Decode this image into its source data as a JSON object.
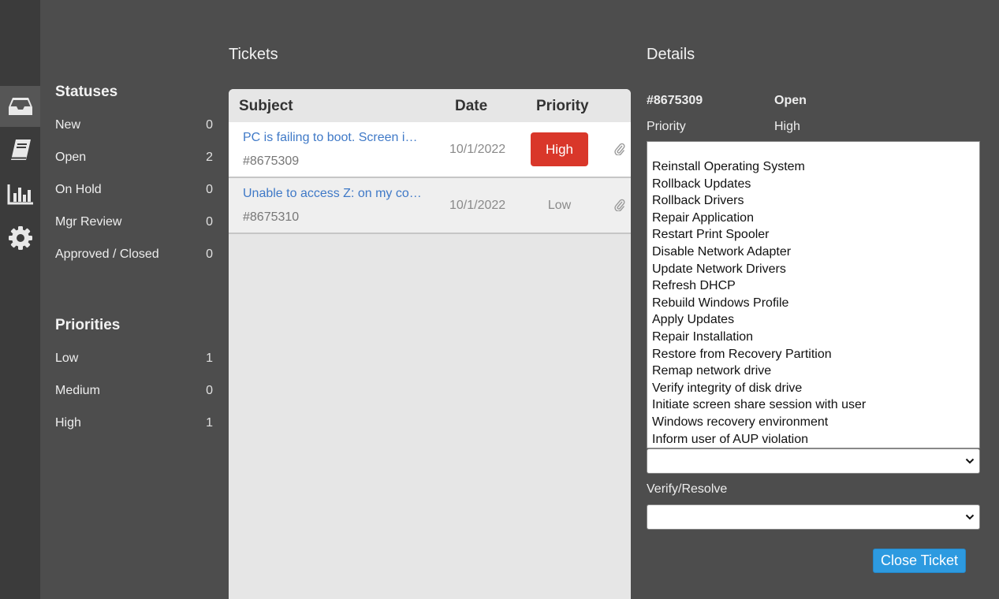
{
  "nav": {
    "icons": [
      "inbox-icon",
      "book-icon",
      "bar-chart-icon",
      "gear-icon"
    ],
    "active": "inbox-icon"
  },
  "statuses": {
    "title": "Statuses",
    "items": [
      {
        "label": "New",
        "count": "0"
      },
      {
        "label": "Open",
        "count": "2"
      },
      {
        "label": "On Hold",
        "count": "0"
      },
      {
        "label": "Mgr Review",
        "count": "0"
      },
      {
        "label": "Approved / Closed",
        "count": "0"
      }
    ]
  },
  "priorities": {
    "title": "Priorities",
    "items": [
      {
        "label": "Low",
        "count": "1"
      },
      {
        "label": "Medium",
        "count": "0"
      },
      {
        "label": "High",
        "count": "1"
      }
    ]
  },
  "tickets": {
    "heading": "Tickets",
    "columns": {
      "subject": "Subject",
      "date": "Date",
      "priority": "Priority"
    },
    "rows": [
      {
        "subject": "PC is failing to boot. Screen i…",
        "id": "#8675309",
        "date": "10/1/2022",
        "priority": "High"
      },
      {
        "subject": "Unable to access Z: on my co…",
        "id": "#8675310",
        "date": "10/1/2022",
        "priority": "Low"
      }
    ]
  },
  "details": {
    "heading": "Details",
    "ticket_id": "#8675309",
    "status": "Open",
    "priority_label": "Priority",
    "priority_value": "High",
    "actions": [
      "Reinstall Operating System",
      "Rollback Updates",
      "Rollback Drivers",
      "Repair Application",
      "Restart Print Spooler",
      "Disable Network Adapter",
      "Update Network Drivers",
      "Refresh DHCP",
      "Rebuild Windows Profile",
      "Apply Updates",
      "Repair Installation",
      "Restore from Recovery Partition",
      "Remap network drive",
      "Verify integrity of disk drive",
      "Initiate screen share session with user",
      "Windows recovery environment",
      "Inform user of AUP violation"
    ],
    "action_select_value": "",
    "verify_label": "Verify/Resolve",
    "verify_select_value": "",
    "close_button": "Close Ticket"
  },
  "colors": {
    "background": "#4d4d4d",
    "rail": "#3b3b3b",
    "link": "#3f79c7",
    "high_badge": "#d9372a",
    "primary_button": "#2d9ae0"
  }
}
